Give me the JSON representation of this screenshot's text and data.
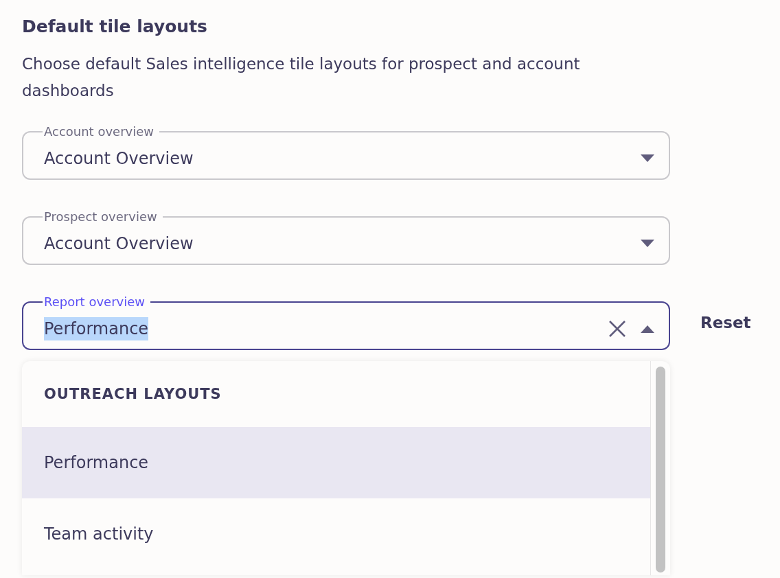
{
  "heading": "Default tile layouts",
  "description": "Choose default Sales intelligence tile layouts for prospect and account dashboards",
  "selects": [
    {
      "label": "Account overview",
      "value": "Account Overview",
      "focused": false,
      "open": false,
      "clearable": false
    },
    {
      "label": "Prospect overview",
      "value": "Account Overview",
      "focused": false,
      "open": false,
      "clearable": false
    },
    {
      "label": "Report overview",
      "value": "Performance",
      "focused": true,
      "open": true,
      "clearable": true
    }
  ],
  "reset_button": "Reset",
  "dropdown": {
    "group": "OUTREACH LAYOUTS",
    "options": [
      {
        "label": "Performance",
        "selected": true
      },
      {
        "label": "Team activity",
        "selected": false
      }
    ]
  }
}
